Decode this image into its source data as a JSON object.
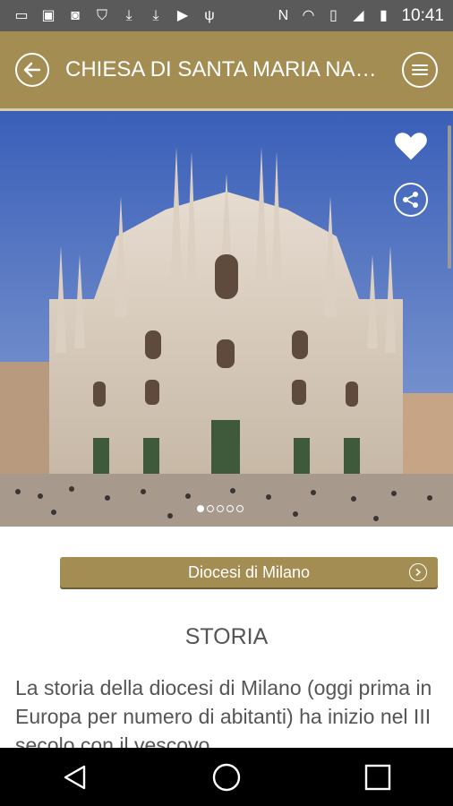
{
  "status_bar": {
    "time": "10:41",
    "left_icons": [
      "chat-icon",
      "image-icon",
      "badge-100-icon",
      "shield-icon",
      "download-icon",
      "download-icon",
      "play-icon",
      "usb-icon"
    ],
    "right_icons": [
      "nfc-icon",
      "wifi-icon",
      "sim-off-icon",
      "signal-icon",
      "battery-icon"
    ]
  },
  "header": {
    "title": "CHIESA DI SANTA MARIA NASCENTE",
    "back_icon": "back-arrow-icon",
    "menu_icon": "menu-icon",
    "color": "#a48d53"
  },
  "gallery": {
    "image": "Duomo di Milano façade photo",
    "slide_count": 5,
    "active_slide": 1
  },
  "diocese_button": {
    "label": "Diocesi di Milano"
  },
  "section": {
    "title": "STORIA",
    "body": "La storia della diocesi di Milano (oggi prima in Europa per numero di abitanti) ha inizio nel III secolo con il vescovo"
  },
  "nav": [
    "back-nav-icon",
    "home-nav-icon",
    "recents-nav-icon"
  ]
}
